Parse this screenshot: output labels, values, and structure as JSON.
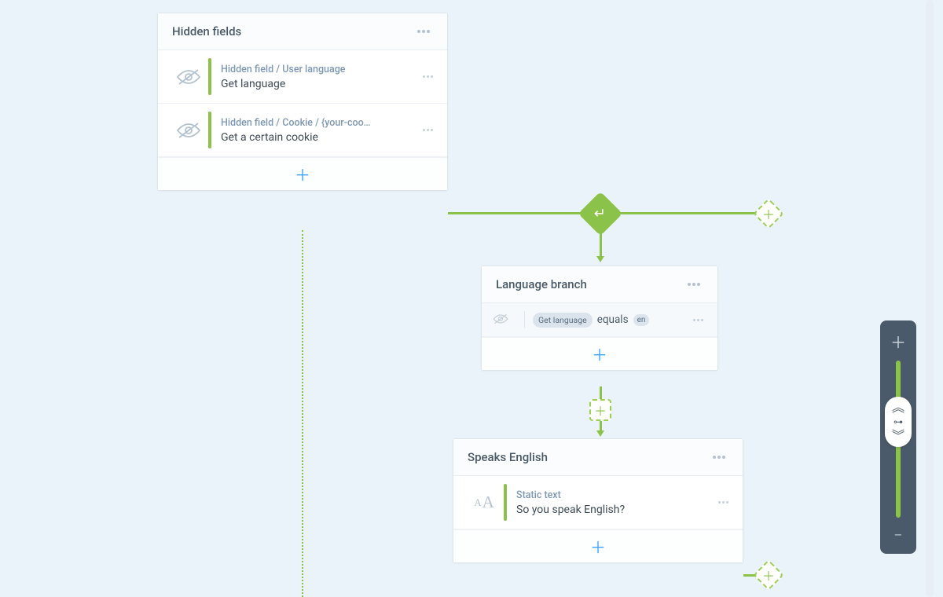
{
  "card1": {
    "title": "Hidden fields",
    "rows": [
      {
        "subtitle": "Hidden field / User language",
        "title": "Get language"
      },
      {
        "subtitle": "Hidden field / Cookie / {your-coo…",
        "title": "Get a certain cookie"
      }
    ]
  },
  "card2": {
    "title": "Language branch",
    "condition": {
      "chip1": "Get language",
      "op": "equals",
      "chip2": "en"
    }
  },
  "card3": {
    "title": "Speaks English",
    "rows": [
      {
        "subtitle": "Static text",
        "title": "So you speak English?"
      }
    ]
  },
  "icons": {
    "plus": "＋",
    "enter": "↵",
    "chev_up": "︽",
    "chev_down": "︾",
    "handle": "⊶",
    "minus": "−"
  }
}
